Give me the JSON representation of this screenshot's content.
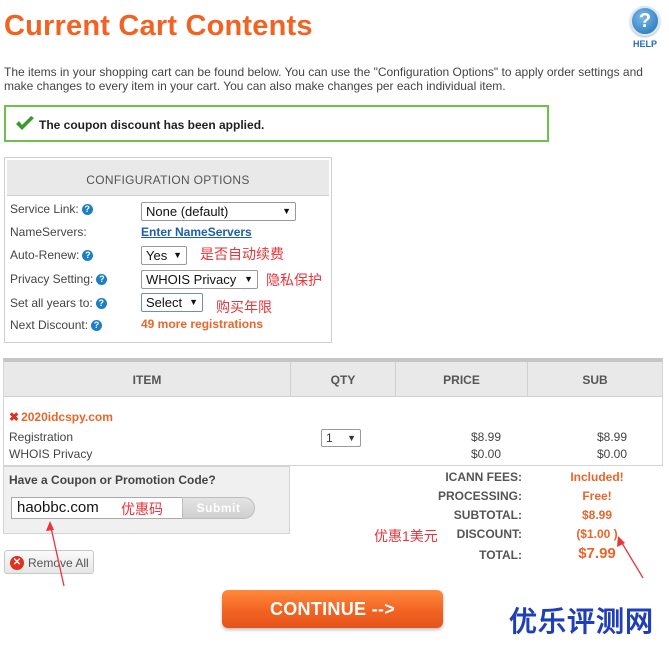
{
  "page_title": "Current Cart Contents",
  "help": {
    "label": "HELP",
    "glyph": "?"
  },
  "intro": "The items in your shopping cart can be found below. You can use the \"Configuration Options\" to apply order settings and make changes to every item in your cart. You can also make changes per each individual item.",
  "coupon_message": "The coupon discount has been applied.",
  "config": {
    "heading": "CONFIGURATION OPTIONS",
    "service_link": {
      "label": "Service Link:",
      "value": "None (default)"
    },
    "nameservers": {
      "label": "NameServers:",
      "link": "Enter NameServers"
    },
    "auto_renew": {
      "label": "Auto-Renew:",
      "value": "Yes"
    },
    "privacy": {
      "label": "Privacy Setting:",
      "value": "WHOIS Privacy"
    },
    "years": {
      "label": "Set all years to:",
      "value": "Select"
    },
    "next_discount": {
      "label": "Next Discount:",
      "value": "49 more registrations"
    }
  },
  "annotations": {
    "auto_renew": "是否自动续费",
    "privacy": "隐私保护",
    "years": "购买年限",
    "coupon": "优惠码",
    "discount": "优惠1美元"
  },
  "cart": {
    "columns": [
      "ITEM",
      "QTY",
      "PRICE",
      "SUB"
    ],
    "domain": "2020idcspy.com",
    "lines": [
      {
        "name": "Registration",
        "price": "$8.99",
        "sub": "$8.99"
      },
      {
        "name": "WHOIS Privacy",
        "price": "$0.00",
        "sub": "$0.00"
      }
    ],
    "qty": "1"
  },
  "promo": {
    "label": "Have a Coupon or Promotion Code?",
    "code": "haobbc.com",
    "submit": "Submit"
  },
  "totals": {
    "icann_label": "ICANN FEES:",
    "icann_value": "Included!",
    "processing_label": "PROCESSING:",
    "processing_value": "Free!",
    "subtotal_label": "SUBTOTAL:",
    "subtotal_value": "$8.99",
    "discount_label": "DISCOUNT:",
    "discount_value": "($1.00 )",
    "total_label": "TOTAL:",
    "total_value": "$7.99"
  },
  "remove_all": "Remove All",
  "continue": "CONTINUE -->",
  "watermark": "优乐评测网",
  "colors": {
    "accent": "#f26322",
    "success_border": "#6cc24a",
    "link": "#1c5fa8",
    "annotation": "#e8343a"
  }
}
